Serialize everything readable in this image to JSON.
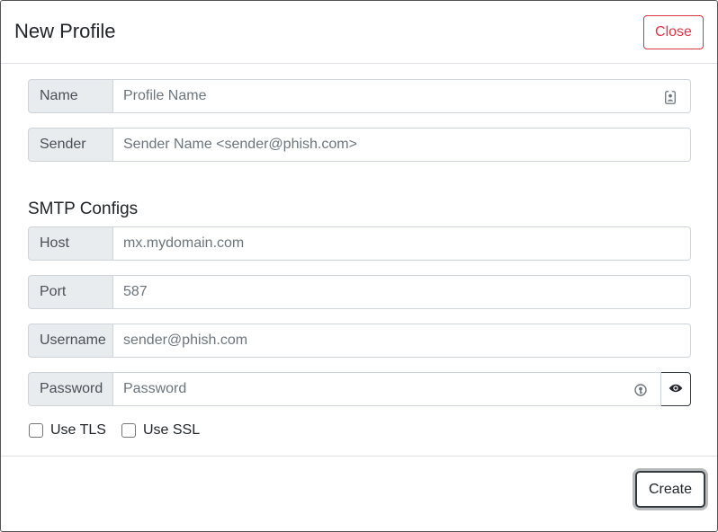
{
  "header": {
    "title": "New Profile",
    "close_label": "Close"
  },
  "profile": {
    "name_label": "Name",
    "name_placeholder": "Profile Name",
    "sender_label": "Sender",
    "sender_placeholder": "Sender Name <sender@phish.com>"
  },
  "smtp": {
    "section_title": "SMTP Configs",
    "host_label": "Host",
    "host_placeholder": "mx.mydomain.com",
    "port_label": "Port",
    "port_placeholder": "587",
    "username_label": "Username",
    "username_placeholder": "sender@phish.com",
    "password_label": "Password",
    "password_placeholder": "Password",
    "use_tls_label": "Use TLS",
    "use_ssl_label": "Use SSL",
    "use_tls_checked": false,
    "use_ssl_checked": false
  },
  "footer": {
    "create_label": "Create"
  },
  "icons": {
    "name_field_icon": "contact-card-icon",
    "password_field_icon": "password-manager-key-icon",
    "toggle_visibility": "eye-icon"
  },
  "colors": {
    "danger": "#dc3545",
    "dark": "#343a40",
    "addon_bg": "#e9ecef"
  }
}
